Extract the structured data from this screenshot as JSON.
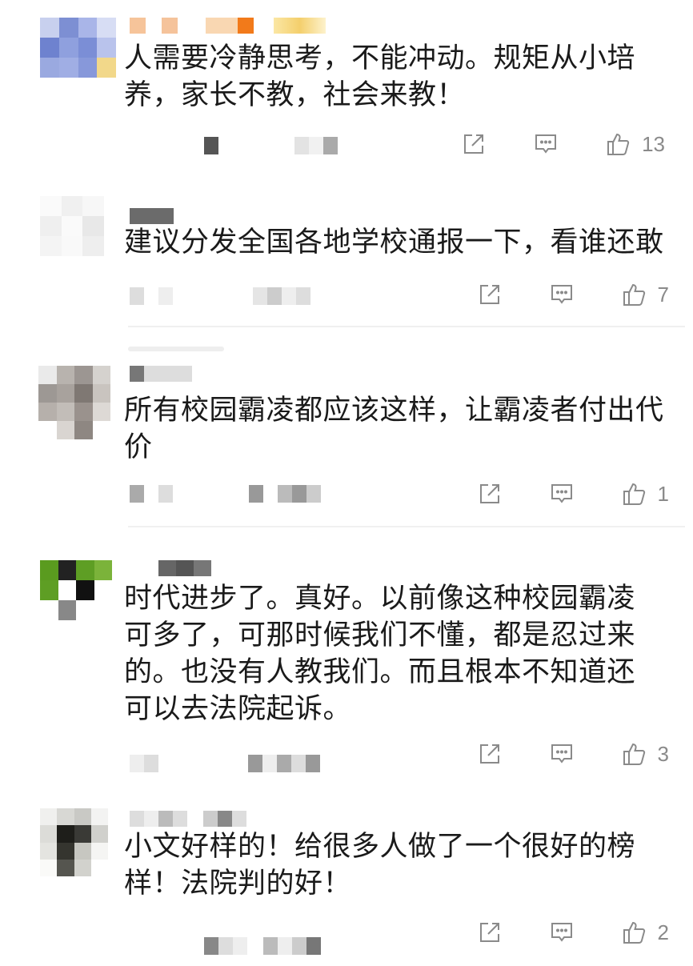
{
  "comments": [
    {
      "text": "人需要冷静思考，不能冲动。规矩从小培养，家长不教，社会来教！",
      "likes": "13"
    },
    {
      "text": "建议分发全国各地学校通报一下，看谁还敢",
      "likes": "7"
    },
    {
      "text": "所有校园霸凌都应该这样，让霸凌者付出代价",
      "likes": "1"
    },
    {
      "text": "时代进步了。真好。以前像这种校园霸凌可多了，可那时候我们不懂，都是忍过来的。也没有人教我们。而且根本不知道还可以去法院起诉。",
      "likes": "3"
    },
    {
      "text": "小文好样的！给很多人做了一个很好的榜样！法院判的好！",
      "likes": "2"
    }
  ],
  "icons": {
    "share": "share-icon",
    "comment": "comment-icon",
    "like": "thumbs-up-icon"
  },
  "colors": {
    "text": "#1a1a1a",
    "icon": "#8a8a8a",
    "count": "#8a8a8a"
  }
}
